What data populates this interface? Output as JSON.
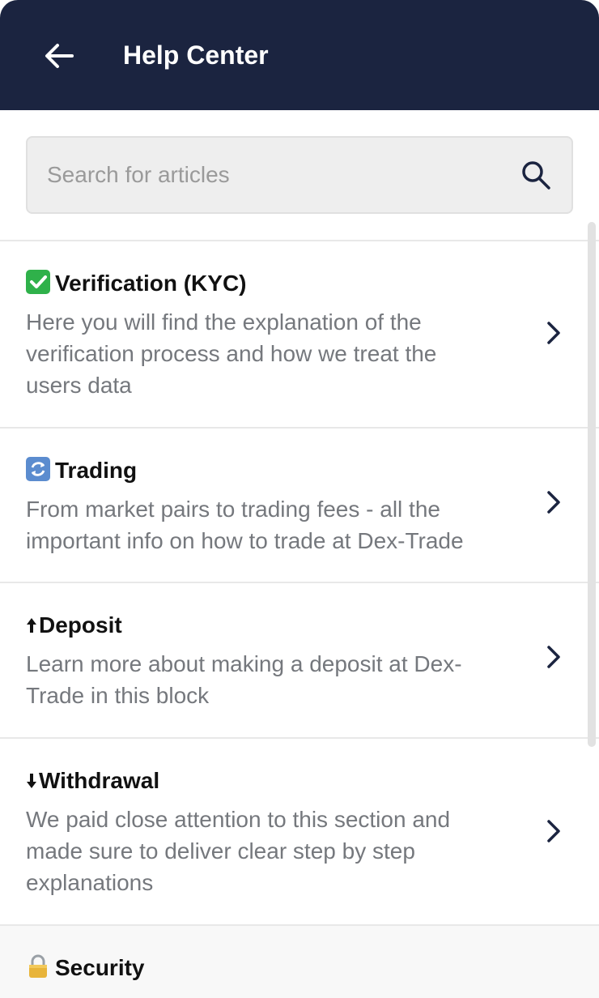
{
  "header": {
    "title": "Help Center",
    "back_icon": "arrow-left-icon"
  },
  "search": {
    "placeholder": "Search for articles",
    "value": "",
    "icon": "search-icon"
  },
  "colors": {
    "header_bg": "#1b2440",
    "title_text": "#111111",
    "desc_text": "#75787d",
    "chevron": "#1b2440"
  },
  "items": [
    {
      "emoji": "check-mark-button-icon",
      "title": "Verification (KYC)",
      "desc": "Here you will find the explanation of the verification process and how we treat the users data"
    },
    {
      "emoji": "counterclockwise-arrows-icon",
      "title": "Trading",
      "desc": "From market pairs to trading fees - all the important info on how to trade at Dex-Trade"
    },
    {
      "emoji": "up-arrow-icon",
      "title": "Deposit",
      "desc": "Learn more about making a deposit at Dex-Trade in this block"
    },
    {
      "emoji": "down-arrow-icon",
      "title": "Withdrawal",
      "desc": "We paid close attention to this section and made sure to deliver clear step by step explanations"
    },
    {
      "emoji": "lock-icon",
      "title": "Security",
      "desc": ""
    }
  ]
}
